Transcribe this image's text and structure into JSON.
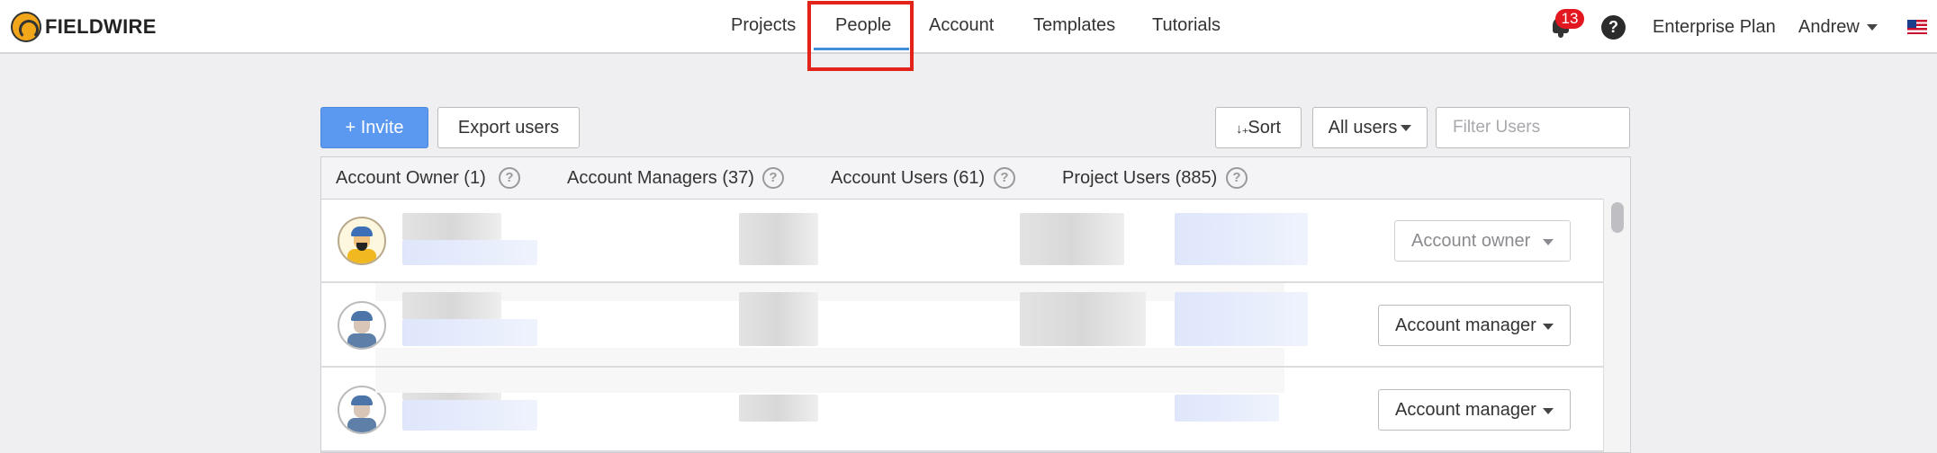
{
  "brand": {
    "name": "FIELDWIRE"
  },
  "nav": {
    "items": [
      {
        "label": "Projects"
      },
      {
        "label": "People"
      },
      {
        "label": "Account"
      },
      {
        "label": "Templates"
      },
      {
        "label": "Tutorials"
      }
    ],
    "active": "People"
  },
  "header_right": {
    "notifications_count": "13",
    "help_label": "?",
    "plan_label": "Enterprise Plan",
    "user_label": "Andrew"
  },
  "toolbar": {
    "invite_label": "+ Invite",
    "export_label": "Export users",
    "sort_label": "Sort",
    "filter_select_label": "All users",
    "filter_placeholder": "Filter Users"
  },
  "tabs": [
    {
      "label": "Account Owner (1)"
    },
    {
      "label": "Account Managers (37)"
    },
    {
      "label": "Account Users (61)"
    },
    {
      "label": "Project Users (885)"
    }
  ],
  "users": [
    {
      "role": "Account owner",
      "role_editable": false
    },
    {
      "role": "Account manager",
      "role_editable": true
    },
    {
      "role": "Account manager",
      "role_editable": true
    }
  ],
  "colors": {
    "primary": "#5b98f0",
    "active_tab_underline": "#3f8ed8",
    "highlight_box": "#e2231a",
    "notification_badge": "#e3171f"
  },
  "icons": {
    "logo": "fieldwire-logo-icon",
    "bell": "bell-icon",
    "help": "help-circle-icon",
    "flag": "us-flag-icon",
    "sort": "sort-alpha-icon",
    "caret": "chevron-down-icon"
  }
}
